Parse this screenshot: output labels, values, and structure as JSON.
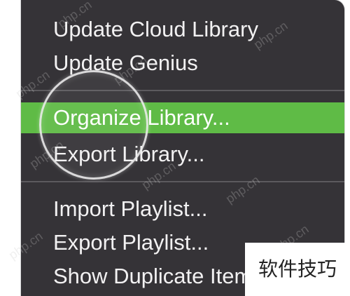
{
  "menu": {
    "items": [
      {
        "label": "Update Cloud Library"
      },
      {
        "label": "Update Genius"
      },
      {
        "label": "Organize Library..."
      },
      {
        "label": "Export Library..."
      },
      {
        "label": "Import Playlist..."
      },
      {
        "label": "Export Playlist..."
      },
      {
        "label": "Show Duplicate Items"
      }
    ],
    "highlighted_index": 2
  },
  "watermark": {
    "text": "php.cn"
  },
  "badge": {
    "text": "软件技巧"
  },
  "colors": {
    "menu_background": "#353337",
    "highlight": "#5fbb46",
    "text": "#f2f1f2"
  }
}
